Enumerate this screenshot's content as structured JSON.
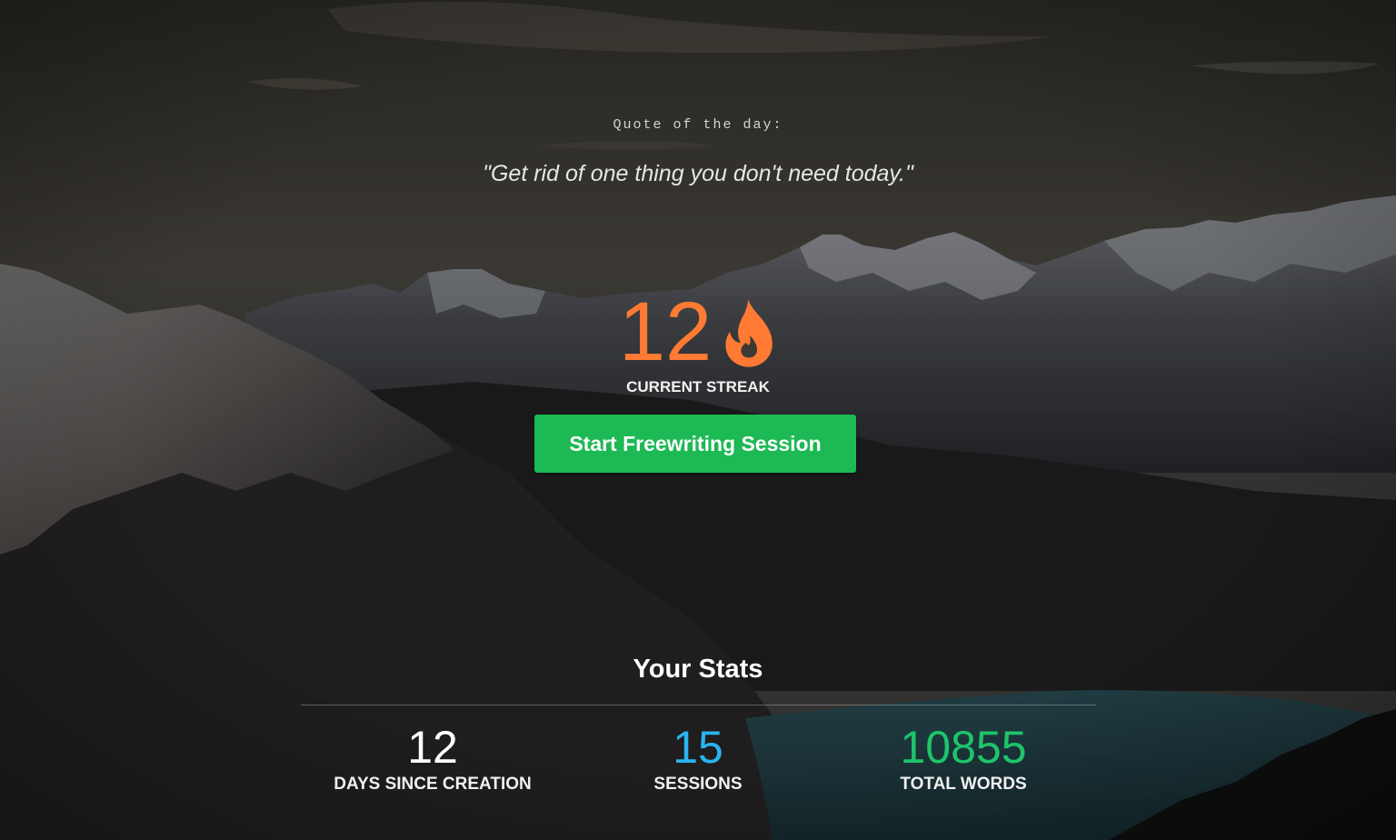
{
  "quote": {
    "label": "Quote of the day:",
    "text": "\"Get rid of one thing you don't need today.\""
  },
  "streak": {
    "value": "12",
    "label": "CURRENT STREAK",
    "icon": "flame-icon",
    "color": "#ff7a33"
  },
  "actions": {
    "start_label": "Start Freewriting Session",
    "start_color": "#1db954"
  },
  "stats": {
    "title": "Your Stats",
    "items": [
      {
        "value": "12",
        "label": "DAYS SINCE CREATION",
        "color": "#ffffff"
      },
      {
        "value": "15",
        "label": "SESSIONS",
        "color": "#2ab4f0"
      },
      {
        "value": "10855",
        "label": "TOTAL WORDS",
        "color": "#1ec46a"
      }
    ]
  }
}
